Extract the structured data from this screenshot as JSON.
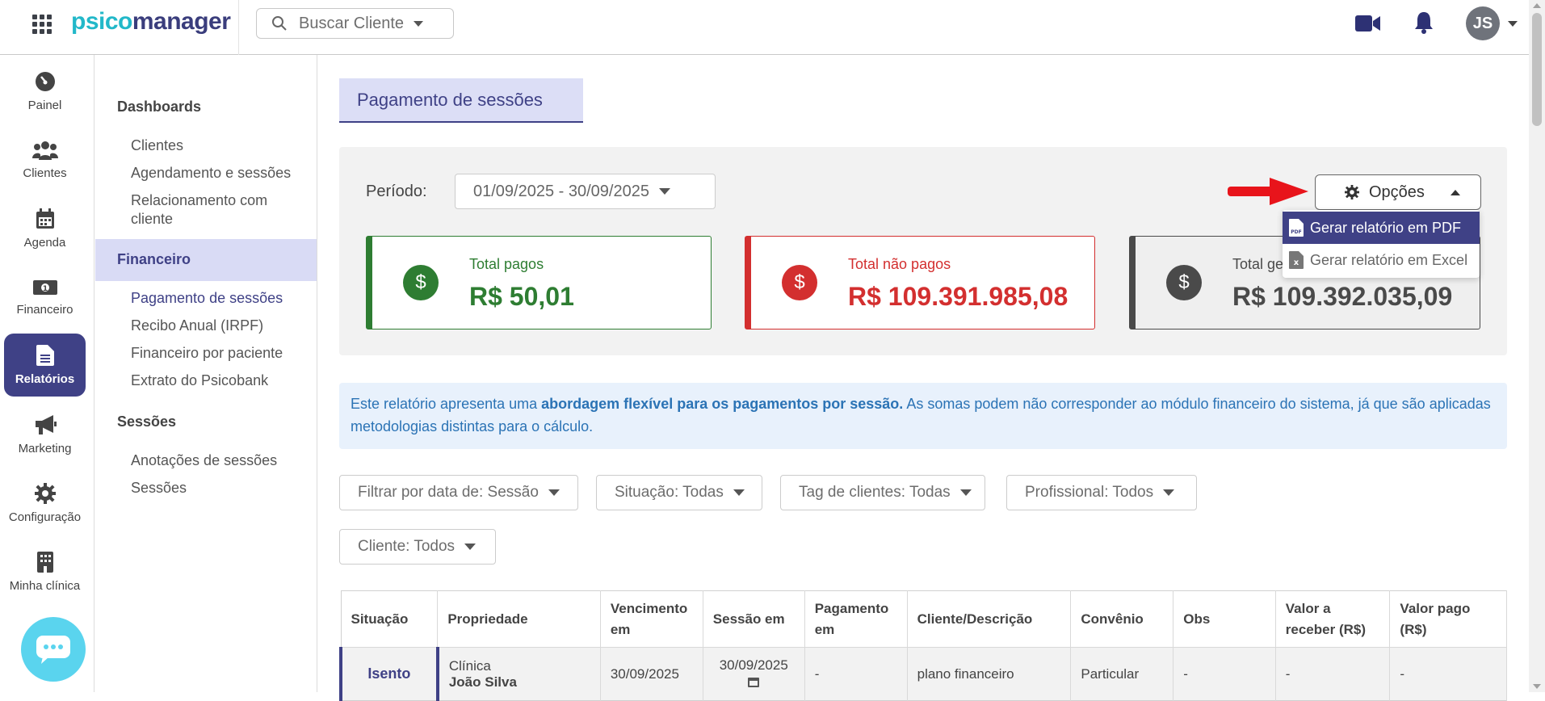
{
  "header": {
    "logo_part1": "psico",
    "logo_part2": "manager",
    "search_placeholder": "Buscar Cliente",
    "avatar_initials": "JS"
  },
  "rail": {
    "items": [
      {
        "label": "Painel",
        "icon": "gauge-icon"
      },
      {
        "label": "Clientes",
        "icon": "users-icon"
      },
      {
        "label": "Agenda",
        "icon": "calendar-icon"
      },
      {
        "label": "Financeiro",
        "icon": "money-icon"
      },
      {
        "label": "Relatórios",
        "icon": "report-icon"
      },
      {
        "label": "Marketing",
        "icon": "megaphone-icon"
      },
      {
        "label": "Configuração",
        "icon": "gear-icon"
      },
      {
        "label": "Minha clínica",
        "icon": "building-icon"
      }
    ]
  },
  "subnav": {
    "dashboards": "Dashboards",
    "clientes": "Clientes",
    "agendamento": "Agendamento e sessões",
    "relacionamento": "Relacionamento com cliente",
    "financeiro": "Financeiro",
    "pagamento": "Pagamento de sessões",
    "recibo": "Recibo Anual (IRPF)",
    "fin_paciente": "Financeiro por paciente",
    "extrato": "Extrato do Psicobank",
    "sessoes_title": "Sessões",
    "anotacoes": "Anotações de sessões",
    "sessoes": "Sessões"
  },
  "main": {
    "title": "Pagamento de sessões",
    "periodo_label": "Período:",
    "periodo_value": "01/09/2025 - 30/09/2025",
    "opcoes_label": "Opções",
    "dropdown": {
      "pdf": "Gerar relatório em PDF",
      "excel": "Gerar relatório em Excel"
    },
    "cards": {
      "pagos_label": "Total pagos",
      "pagos_value": "R$ 50,01",
      "nao_pagos_label": "Total não pagos",
      "nao_pagos_value": "R$ 109.391.985,08",
      "geral_label": "Total ge",
      "geral_value": "R$ 109.392.035,09"
    },
    "info": {
      "part1": "Este relatório apresenta uma ",
      "bold": "abordagem flexível para os pagamentos por sessão.",
      "part2": " As somas podem não corresponder ao módulo financeiro do sistema, já que são aplicadas metodologias distintas para o cálculo."
    },
    "filters": {
      "data": "Filtrar por data de: Sessão",
      "situacao": "Situação: Todas",
      "tag": "Tag de clientes: Todas",
      "profissional": "Profissional: Todos",
      "cliente": "Cliente: Todos"
    }
  },
  "table": {
    "headers": [
      "Situação",
      "Propriedade",
      "Vencimento em",
      "Sessão em",
      "Pagamento em",
      "Cliente/Descrição",
      "Convênio",
      "Obs",
      "Valor a receber (R$)",
      "Valor pago (R$)"
    ],
    "row": {
      "situacao": "Isento",
      "prop_line1": "Clínica",
      "prop_line2": "João Silva",
      "vencimento": "30/09/2025",
      "sessao": "30/09/2025",
      "pagamento": "-",
      "cliente": "plano financeiro",
      "convenio": "Particular",
      "obs": "-",
      "valor_receber": "-",
      "valor_pago": "-"
    }
  },
  "colors": {
    "brand": "#3f4186",
    "green": "#2e7d32",
    "red": "#d32f2f",
    "dark": "#4a4a4a",
    "info_bg": "#e8f1fc"
  }
}
